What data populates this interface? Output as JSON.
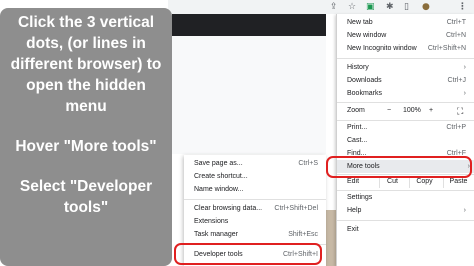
{
  "instructions": {
    "step1": "Click the 3 vertical dots, (or lines in different browser) to open the hidden menu",
    "step2": "Hover \"More tools\"",
    "step3": "Select \"Developer tools\""
  },
  "toolbar": {
    "icons": [
      "share-icon",
      "star-icon",
      "extension-icon",
      "puzzle-icon",
      "sidebar-icon",
      "profile-icon",
      "three-dots-icon"
    ]
  },
  "main_menu": {
    "new_tab": "New tab",
    "new_tab_sc": "Ctrl+T",
    "new_window": "New window",
    "new_window_sc": "Ctrl+N",
    "incognito": "New Incognito window",
    "incognito_sc": "Ctrl+Shift+N",
    "history": "History",
    "downloads": "Downloads",
    "downloads_sc": "Ctrl+J",
    "bookmarks": "Bookmarks",
    "zoom": "Zoom",
    "zoom_minus": "−",
    "zoom_value": "100%",
    "zoom_plus": "+",
    "print": "Print...",
    "print_sc": "Ctrl+P",
    "cast": "Cast...",
    "find": "Find...",
    "find_sc": "Ctrl+F",
    "more_tools": "More tools",
    "edit": "Edit",
    "cut": "Cut",
    "copy": "Copy",
    "paste": "Paste",
    "settings": "Settings",
    "help": "Help",
    "exit": "Exit"
  },
  "sub_menu": {
    "save_page": "Save page as...",
    "save_page_sc": "Ctrl+S",
    "create_shortcut": "Create shortcut...",
    "name_window": "Name window...",
    "clear_data": "Clear browsing data...",
    "clear_data_sc": "Ctrl+Shift+Del",
    "extensions": "Extensions",
    "task_manager": "Task manager",
    "task_manager_sc": "Shift+Esc",
    "dev_tools": "Developer tools",
    "dev_tools_sc": "Ctrl+Shift+I"
  },
  "colors": {
    "highlight": "#e02020",
    "panel": "#8e8e8e"
  }
}
